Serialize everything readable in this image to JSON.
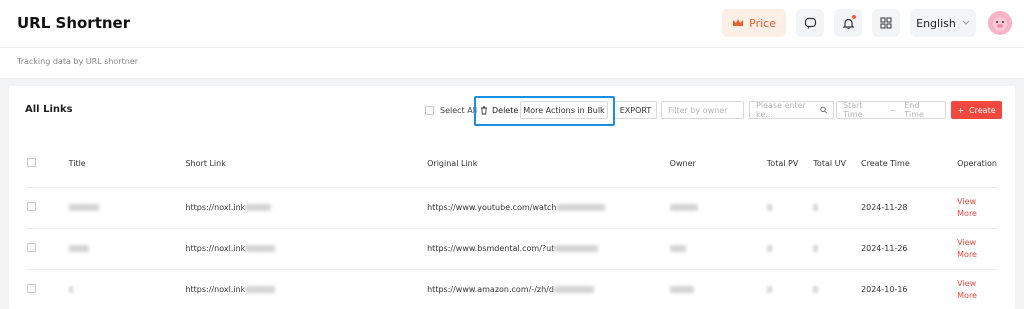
{
  "header": {
    "title": "URL Shortner",
    "price_label": "Price",
    "language": "English"
  },
  "subtitle": "Tracking data by URL shortner",
  "panel": {
    "title": "All Links",
    "select_all": "Select All",
    "delete_label": "Delete",
    "bulk_label": "More Actions in Bulk",
    "export_label": "EXPORT",
    "owner_placeholder": "Filter by owner",
    "keyword_placeholder": "Please enter ke...",
    "start_time": "Start Time",
    "end_time": "End Time",
    "create_label": "Create"
  },
  "table": {
    "columns": [
      "Title",
      "Short Link",
      "Original Link",
      "Owner",
      "Total PV",
      "Total UV",
      "Create Time",
      "Operation"
    ],
    "rows": [
      {
        "short": "https://noxl.ink",
        "original": "https://www.youtube.com/watch",
        "date": "2024-11-28",
        "view": "View",
        "more": "More"
      },
      {
        "short": "https://noxl.ink",
        "original": "https://www.bsmdental.com/?ut",
        "date": "2024-11-26",
        "view": "View",
        "more": "More"
      },
      {
        "short": "https://noxl.ink",
        "original": "https://www.amazon.com/-/zh/d",
        "date": "2024-10-16",
        "view": "View",
        "more": "More"
      }
    ]
  },
  "colors": {
    "accent": "#f0483e",
    "highlight": "#1a8fe0",
    "price": "#e8602c"
  },
  "icons": [
    "crown-icon",
    "chat-icon",
    "bell-icon",
    "grid-icon",
    "chevron-down-icon",
    "trash-icon",
    "search-icon",
    "plus-icon"
  ]
}
